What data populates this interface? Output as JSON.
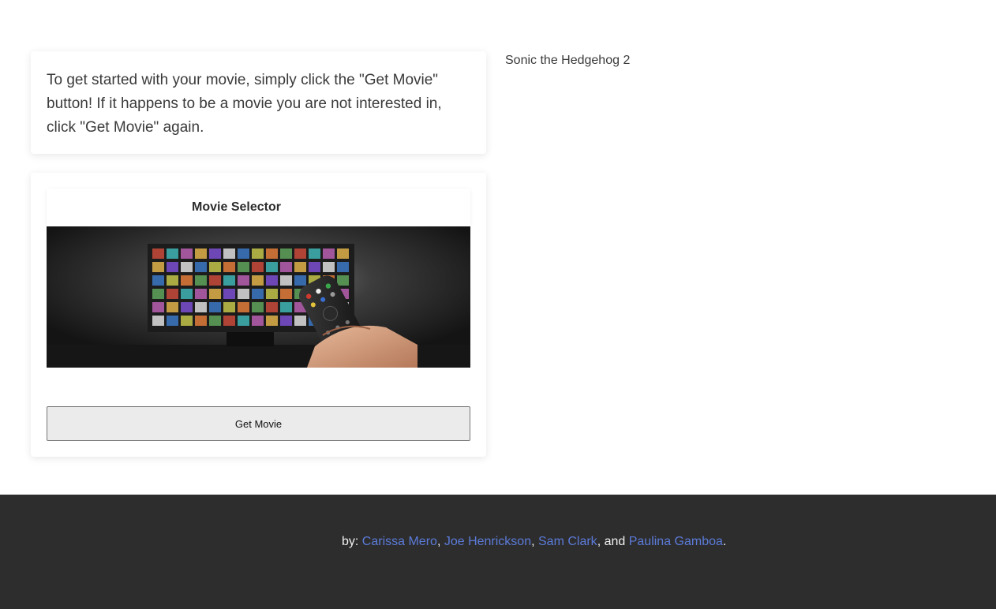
{
  "intro": {
    "text": "To get started with your movie, simply click the \"Get Movie\" button! If it happens to be a movie you are not interested in, click \"Get Movie\" again."
  },
  "selector": {
    "title": "Movie Selector",
    "image_alt": "TV remote pointed at a streaming library",
    "button_label": "Get Movie"
  },
  "result": {
    "movie_title": "Sonic the Hedgehog 2"
  },
  "footer": {
    "prefix": "by: ",
    "authors": [
      "Carissa Mero",
      "Joe Henrickson",
      "Sam Clark",
      "Paulina Gamboa"
    ],
    "sep1": ", ",
    "sep2": ", ",
    "sep3": ", and ",
    "suffix": "."
  },
  "colors": {
    "footer_bg": "#2e2d2e",
    "link": "#5a7bd8",
    "button_bg": "#ebebeb"
  }
}
